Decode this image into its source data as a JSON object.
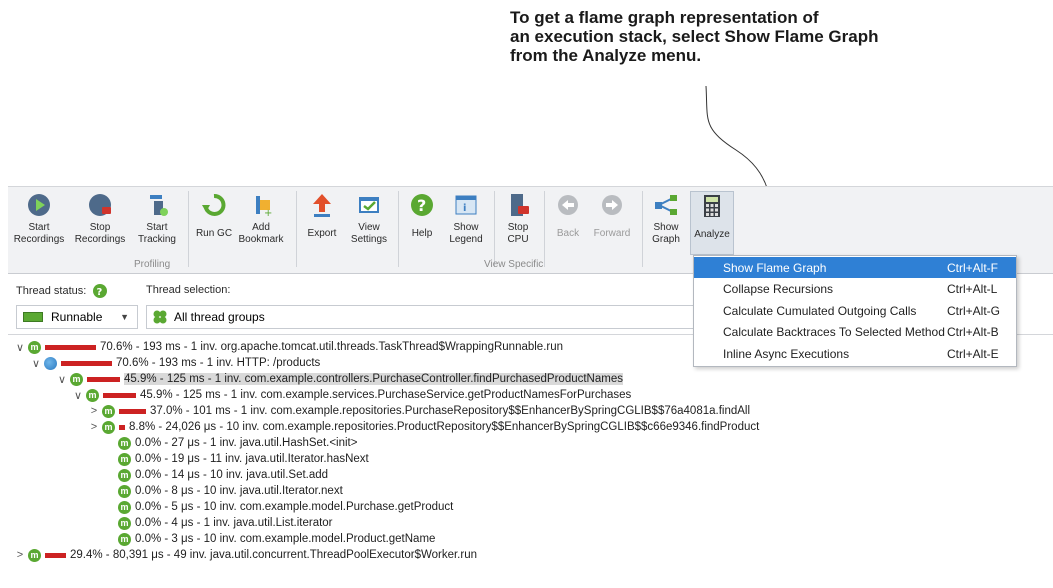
{
  "annotation": "To get a flame graph representation of\nan execution stack, select Show Flame Graph\nfrom the Analyze menu.",
  "toolbar": {
    "start_recordings": "Start\nRecordings",
    "stop_recordings": "Stop\nRecordings",
    "start_tracking": "Start\nTracking",
    "run_gc": "Run GC",
    "add_bookmark": "Add\nBookmark",
    "export": "Export",
    "view_settings": "View\nSettings",
    "help": "Help",
    "show_legend": "Show\nLegend",
    "stop_cpu": "Stop\nCPU",
    "back": "Back",
    "forward": "Forward",
    "show_graph": "Show\nGraph",
    "analyze": "Analyze",
    "group_profiling": "Profiling",
    "group_view_specific": "View Specific"
  },
  "filters": {
    "thread_status_label": "Thread status:",
    "thread_status_value": "Runnable",
    "thread_selection_label": "Thread selection:",
    "thread_selection_value": "All thread groups"
  },
  "tree": {
    "rows": [
      {
        "text": "70.6% - 193 ms - 1 inv. org.apache.tomcat.util.threads.TaskThread$WrappingRunnable.run",
        "share": 70.6,
        "expander": "∨",
        "icon": "m"
      },
      {
        "text": "70.6% - 193 ms - 1 inv. HTTP: /products",
        "share": 70.6,
        "expander": "∨",
        "icon": "globe"
      },
      {
        "text": "45.9% - 125 ms - 1 inv. com.example.controllers.PurchaseController.findPurchasedProductNames",
        "share": 45.9,
        "expander": "∨",
        "icon": "m",
        "highlighted": true
      },
      {
        "text": "45.9% - 125 ms - 1 inv. com.example.services.PurchaseService.getProductNamesForPurchases",
        "share": 45.9,
        "expander": "∨",
        "icon": "m"
      },
      {
        "text": "37.0% - 101 ms - 1 inv. com.example.repositories.PurchaseRepository$$EnhancerBySpringCGLIB$$76a4081a.findAll",
        "share": 37.0,
        "expander": ">",
        "icon": "m"
      },
      {
        "text": "8.8% - 24,026 μs - 10 inv. com.example.repositories.ProductRepository$$EnhancerBySpringCGLIB$$c66e9346.findProduct",
        "share": 8.8,
        "expander": ">",
        "icon": "m"
      },
      {
        "text": "0.0% - 27 μs - 1 inv. java.util.HashSet.<init>",
        "share": 0,
        "expander": "",
        "icon": "m"
      },
      {
        "text": "0.0% - 19 μs - 11 inv. java.util.Iterator.hasNext",
        "share": 0,
        "expander": "",
        "icon": "m"
      },
      {
        "text": "0.0% - 14 μs - 10 inv. java.util.Set.add",
        "share": 0,
        "expander": "",
        "icon": "m"
      },
      {
        "text": "0.0% - 8 μs - 10 inv. java.util.Iterator.next",
        "share": 0,
        "expander": "",
        "icon": "m"
      },
      {
        "text": "0.0% - 5 μs - 10 inv. com.example.model.Purchase.getProduct",
        "share": 0,
        "expander": "",
        "icon": "m"
      },
      {
        "text": "0.0% - 4 μs - 1 inv. java.util.List.iterator",
        "share": 0,
        "expander": "",
        "icon": "m"
      },
      {
        "text": "0.0% - 3 μs - 10 inv. com.example.model.Product.getName",
        "share": 0,
        "expander": "",
        "icon": "m"
      },
      {
        "text": "29.4% - 80,391 μs - 49 inv. java.util.concurrent.ThreadPoolExecutor$Worker.run",
        "share": 29.4,
        "expander": ">",
        "icon": "m"
      }
    ]
  },
  "menu": {
    "items": [
      {
        "label": "Show Flame Graph",
        "shortcut": "Ctrl+Alt-F",
        "selected": true
      },
      {
        "label": "Collapse Recursions",
        "shortcut": "Ctrl+Alt-L"
      },
      {
        "label": "Calculate Cumulated Outgoing Calls",
        "shortcut": "Ctrl+Alt-G"
      },
      {
        "label": "Calculate Backtraces To Selected Method",
        "shortcut": "Ctrl+Alt-B"
      },
      {
        "label": "Inline Async Executions",
        "shortcut": "Ctrl+Alt-E"
      }
    ]
  },
  "colors": {
    "accent": "#2f80d5",
    "bar": "#cc2222",
    "method_icon": "#5aa832"
  }
}
